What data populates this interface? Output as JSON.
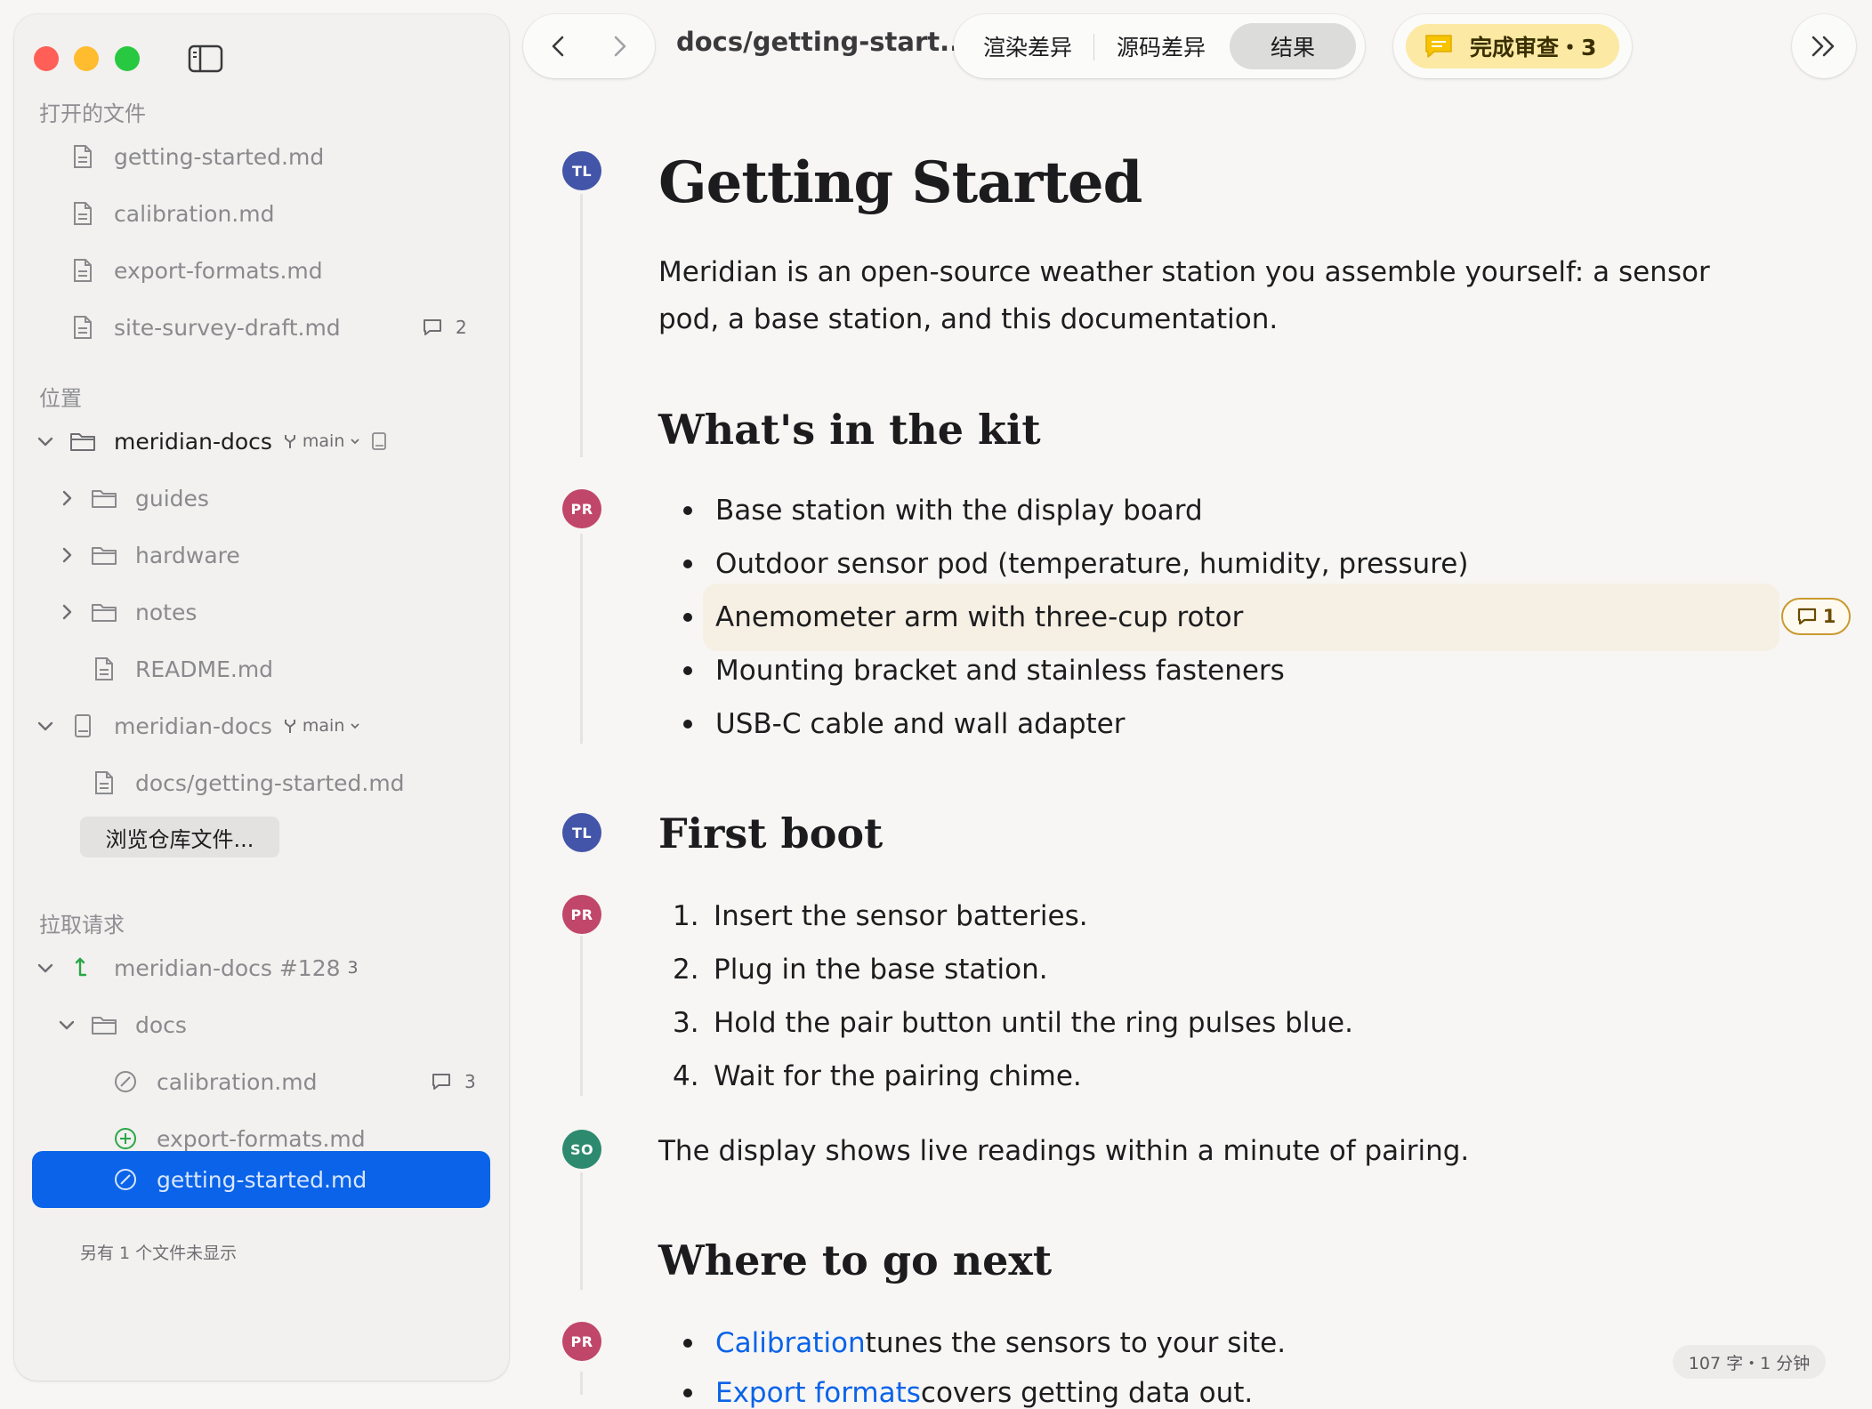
{
  "sidebar": {
    "open_files": {
      "title": "打开的文件",
      "items": [
        {
          "label": "getting-started.md"
        },
        {
          "label": "calibration.md"
        },
        {
          "label": "export-formats.md"
        },
        {
          "label": "site-survey-draft.md",
          "comments": "2"
        }
      ]
    },
    "locations": {
      "title": "位置",
      "repo1": {
        "label": "meridian-docs",
        "branch": "main"
      },
      "folders": [
        {
          "label": "guides"
        },
        {
          "label": "hardware"
        },
        {
          "label": "notes"
        }
      ],
      "readme": "README.md",
      "repo2": {
        "label": "meridian-docs",
        "branch": "main"
      },
      "repo2_file": "docs/getting-started.md",
      "browse_button": "浏览仓库文件..."
    },
    "pull_requests": {
      "title": "拉取请求",
      "pr": {
        "label": "meridian-docs #128",
        "count": "3"
      },
      "folder": "docs",
      "files": [
        {
          "label": "calibration.md",
          "status": "modified",
          "comments": "3"
        },
        {
          "label": "export-formats.md",
          "status": "added"
        },
        {
          "label": "getting-started.md",
          "status": "modified",
          "selected": true
        }
      ],
      "more_files": "另有 1 个文件未显示"
    }
  },
  "toolbar": {
    "doc_title": "docs/getting-start...",
    "segments": [
      "渲染差异",
      "源码差异",
      "结果"
    ],
    "active_segment": "结果",
    "review_label": "完成审查・3"
  },
  "document": {
    "title": "Getting Started",
    "intro": "Meridian is an open-source weather station you assemble yourself: a sensor pod, a base station, and this documentation.",
    "sections": [
      {
        "heading": "What's in the kit",
        "items": [
          "Base station with the display board",
          "Outdoor sensor pod (temperature, humidity, pressure)",
          "Anemometer arm with three-cup rotor",
          "Mounting bracket and stainless fasteners",
          "USB-C cable and wall adapter"
        ],
        "comment_count": "1"
      },
      {
        "heading": "First boot",
        "steps": [
          {
            "n": "1.",
            "text": "Insert the sensor batteries."
          },
          {
            "n": "2.",
            "text": "Plug in the base station."
          },
          {
            "n": "3.",
            "text": "Hold the pair button until the ring pulses blue."
          },
          {
            "n": "4.",
            "text": "Wait for the pairing chime."
          }
        ],
        "after": "The display shows live readings within a minute of pairing."
      },
      {
        "heading": "Where to go next",
        "items": [
          {
            "link": "Calibration",
            "text": " tunes the sensors to your site."
          },
          {
            "link": "Export formats",
            "text": " covers getting data out."
          }
        ]
      }
    ],
    "authors": {
      "tl": "TL",
      "pr": "PR",
      "so": "SO"
    }
  },
  "status": {
    "word_count": "107 字・1 分钟"
  },
  "colors": {
    "accent": "#0a63e8",
    "review": "#fce9a3",
    "tl": "#4355a8",
    "pr": "#c0476a",
    "so": "#2e8a6e"
  }
}
